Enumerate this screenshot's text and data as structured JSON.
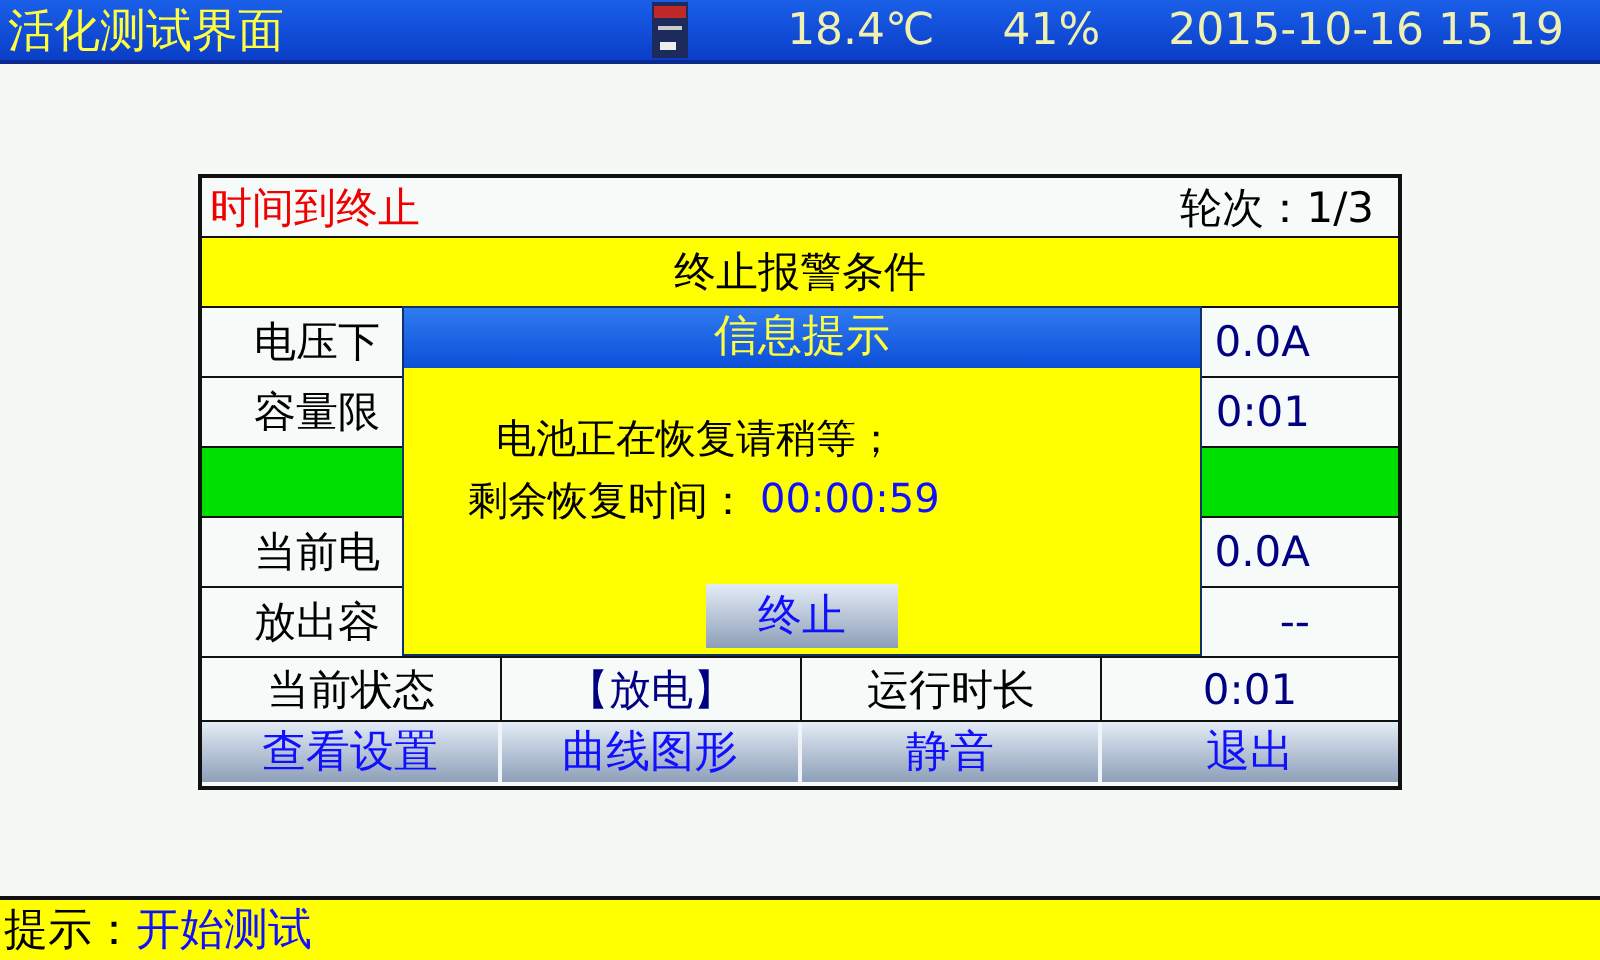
{
  "header": {
    "title": "活化测试界面",
    "temperature": "18.4℃",
    "humidity": "41%",
    "datetime": "2015-10-16 15 19"
  },
  "panel": {
    "status": "时间到终止",
    "round": "轮次：1/3",
    "rows": [
      {
        "kind": "band",
        "text": "终止报警条件",
        "color": "#ffff00"
      },
      {
        "kind": "pair",
        "label": "电压下",
        "value": "0.0A"
      },
      {
        "kind": "pair",
        "label": "容量限",
        "value": "0:01"
      },
      {
        "kind": "band",
        "color": "#00e000"
      },
      {
        "kind": "pair",
        "label": "当前电",
        "value": "0.0A"
      },
      {
        "kind": "pair",
        "label": "放出容",
        "value": "--"
      },
      {
        "kind": "quad",
        "cells": [
          "当前状态",
          "【放电】",
          "运行时长",
          "0:01"
        ]
      }
    ],
    "buttons": [
      "查看设置",
      "曲线图形",
      "静音",
      "退出"
    ]
  },
  "dialog": {
    "title": "信息提示",
    "message": "电池正在恢复请稍等；",
    "time_label": "剩余恢复时间：",
    "time_value": "00:00:59",
    "button": "终止"
  },
  "footer": {
    "label": "提示：",
    "value": "开始测试"
  }
}
